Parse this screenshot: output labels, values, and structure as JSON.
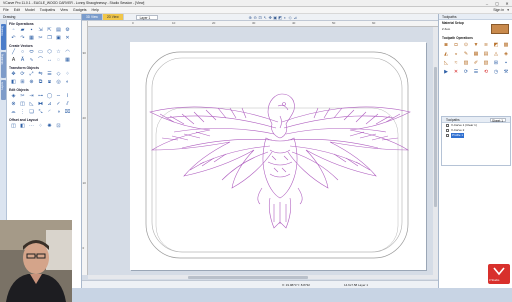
{
  "window": {
    "title": "VCarve Pro 11.0.1 - EAGLE_WOOD CARVER - Lonny Shaughnessy - Studio Session - [View]",
    "controls": [
      "–",
      "▢",
      "✕"
    ]
  },
  "menu": {
    "items": [
      "File",
      "Edit",
      "Model",
      "Toolpaths",
      "View",
      "Gadgets",
      "Help"
    ],
    "right": [
      "Sign in",
      "▾"
    ]
  },
  "left_panel": {
    "tab": "Drawing",
    "side_tabs": [
      "Drawing",
      "Modeling",
      "Layers"
    ],
    "sections": [
      {
        "title": "File Operations",
        "icons": [
          "new-file-icon",
          "open-file-icon",
          "save-file-icon",
          "import-icon",
          "export-icon",
          "print-icon",
          "undo-icon",
          "redo-icon",
          "job-setup-icon",
          "settings-icon",
          "cut-icon",
          "copy-icon",
          "paste-icon",
          "delete-icon"
        ]
      },
      {
        "title": "Create Vectors",
        "icons": [
          "line-icon",
          "circle-icon",
          "ellipse-icon",
          "rectangle-icon",
          "polygon-icon",
          "star-icon",
          "arc-icon",
          "text-icon",
          "text-arc-icon",
          "draw-curve-icon",
          "fillet-icon",
          "dimension-icon",
          "offset-icon",
          "trace-icon",
          "spiral-icon",
          "grid-icon"
        ]
      },
      {
        "title": "Transform Objects",
        "icons": [
          "move-icon",
          "rotate-icon",
          "scale-icon",
          "mirror-icon",
          "align-icon",
          "distort-icon",
          "array-icon",
          "nest-icon",
          "size-icon",
          "center-icon",
          "group-icon",
          "ungroup-icon",
          "weld-icon",
          "subtract-icon"
        ]
      },
      {
        "title": "Edit Objects",
        "icons": [
          "node-edit-icon",
          "trim-icon",
          "extend-icon",
          "join-icon",
          "close-icon",
          "smooth-icon",
          "curve-fit-icon",
          "weld-icon",
          "intersect-icon",
          "offset-icon",
          "fillet-icon",
          "chamfer-icon",
          "cut-icon",
          "interlock-icon",
          "measure-icon",
          "check-icon",
          "align-nodes-icon",
          "slice-icon",
          "bend-icon",
          "scale-icon",
          "duplicate-icon"
        ]
      },
      {
        "title": "Offset and Layout",
        "icons": [
          "offset-icon",
          "nest-icon",
          "copy-along-icon",
          "array-icon",
          "circular-array-icon",
          "fit-icon"
        ]
      }
    ]
  },
  "canvas": {
    "tabs": [
      {
        "label": "3D View",
        "state": "active"
      },
      {
        "label": "2D View",
        "state": "inactive"
      }
    ],
    "layer_selector": "Layer 1",
    "view_icons": [
      "zoom-in-icon",
      "zoom-out-icon",
      "zoom-extents-icon",
      "select-icon",
      "pan-icon",
      "view-top-icon",
      "view-iso-icon",
      "shading-icon",
      "wireframe-icon",
      "measure-icon"
    ],
    "ruler_top": [
      "0",
      "10",
      "20",
      "30",
      "40",
      "50",
      "60"
    ],
    "ruler_left": [
      "30",
      "20",
      "10",
      "0"
    ],
    "status": {
      "coords": "X: 19.9873   Y: 8.8732",
      "layer": "14.6x7.58   Layer 1"
    }
  },
  "right_panel": {
    "title": "Toolpaths",
    "material_label": "Material Setup",
    "material_detail": "Z Zero",
    "toolpath_ops_title": "Toolpath Operations",
    "toolpath_icons": [
      "profile-icon",
      "pocket-icon",
      "drill-icon",
      "vcarve-icon",
      "fluting-icon",
      "inlay-icon",
      "texture-icon",
      "prism-icon",
      "moulding-icon",
      "quick-engrave-icon",
      "roughing-icon",
      "finishing-icon",
      "project-icon",
      "3d-profile-icon",
      "chamfer-icon",
      "fluting-icon",
      "texture-icon",
      "engrave-icon",
      "template-icon",
      "merge-icon",
      "save-icon",
      "preview-icon",
      "delete-icon",
      "calculate-icon",
      "summary-icon",
      "reset-icon",
      "time-icon",
      "tools-icon"
    ],
    "toolpaths_box": {
      "title": "Toolpaths",
      "sheet_label": "Sheet 1",
      "rows": [
        {
          "label": "V-Carve 1 (Clear 1)",
          "checked": true,
          "selected": false
        },
        {
          "label": "V-Carve 2",
          "checked": true,
          "selected": false
        },
        {
          "label": "Profile 1",
          "checked": true,
          "selected": true
        }
      ]
    }
  },
  "corner_logo": {
    "text": "3 Studio"
  }
}
